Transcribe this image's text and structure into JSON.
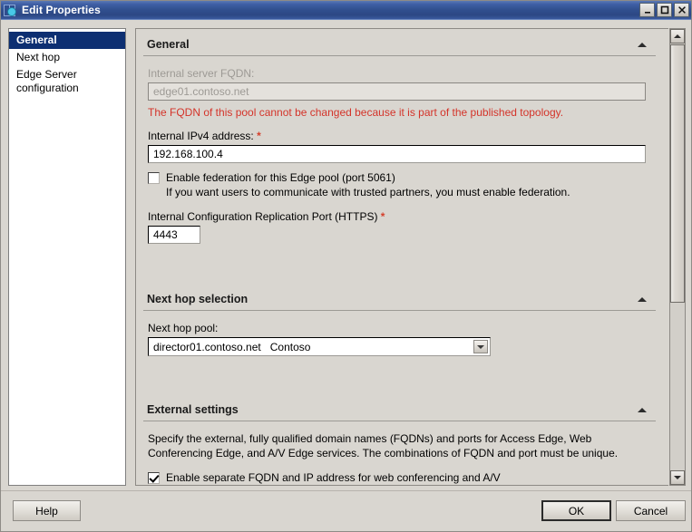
{
  "window": {
    "title": "Edit Properties",
    "icon": "lync-edge-icon",
    "controls": {
      "minimize": "minimize-icon",
      "maximize": "maximize-icon",
      "close": "close-icon"
    }
  },
  "sidebar": {
    "items": [
      {
        "label": "General",
        "selected": true
      },
      {
        "label": "Next hop",
        "selected": false
      },
      {
        "label": "Edge Server configuration",
        "selected": false
      }
    ]
  },
  "sections": {
    "general": {
      "heading": "General",
      "collapse_icon": "caret-up-icon",
      "fqdn_label": "Internal server FQDN:",
      "fqdn_value": "edge01.contoso.net",
      "fqdn_error": "The FQDN of this pool cannot be changed because it is part of the published topology.",
      "ipv4_label": "Internal IPv4 address:",
      "ipv4_required": "*",
      "ipv4_value": "192.168.100.4",
      "federation_checkbox_label": "Enable federation for this Edge pool (port 5061)",
      "federation_checked": false,
      "federation_note": "If you want users to communicate with trusted partners, you must enable federation.",
      "repl_port_label": "Internal Configuration Replication Port (HTTPS)",
      "repl_port_required": "*",
      "repl_port_value": "4443"
    },
    "next_hop": {
      "heading": "Next hop selection",
      "collapse_icon": "caret-up-icon",
      "pool_label": "Next hop pool:",
      "pool_value": "director01.contoso.net   Contoso",
      "dropdown_icon": "chevron-down-icon"
    },
    "external": {
      "heading": "External settings",
      "collapse_icon": "caret-up-icon",
      "description": "Specify the external, fully qualified domain names (FQDNs) and ports for Access Edge, Web Conferencing Edge, and A/V Edge services. The combinations of FQDN and port must be unique.",
      "separate_fqdn_label": "Enable separate FQDN and IP address for web conferencing and A/V",
      "separate_fqdn_checked": true
    }
  },
  "scrollbar": {
    "up_icon": "scroll-up-arrow-icon",
    "down_icon": "scroll-down-arrow-icon"
  },
  "footer": {
    "help_label": "Help",
    "ok_label": "OK",
    "cancel_label": "Cancel"
  },
  "colors": {
    "titlebar": "#31508f",
    "selection": "#0d2f72",
    "error_text": "#d4342a",
    "required_mark": "#d4402c",
    "dialog_bg": "#d9d6d0"
  }
}
